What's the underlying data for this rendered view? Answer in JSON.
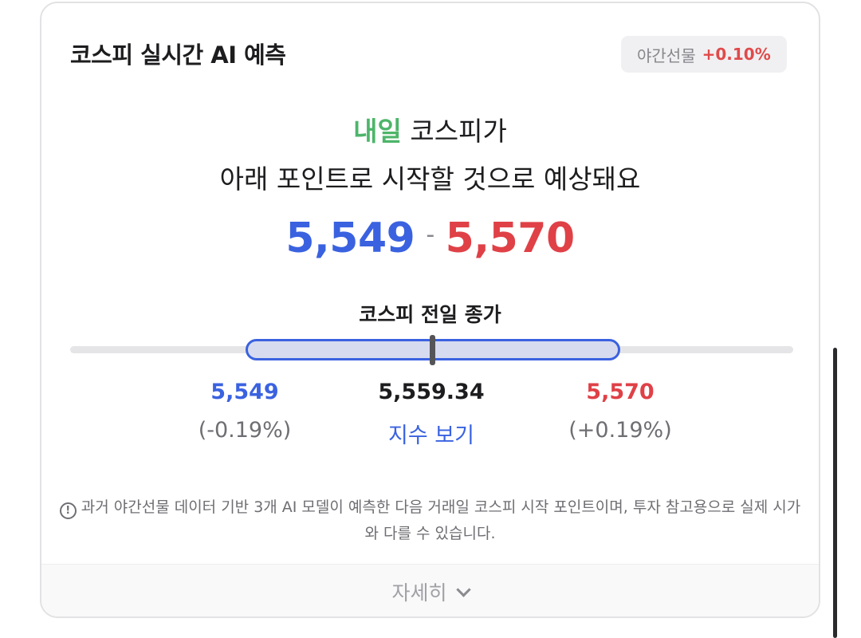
{
  "card": {
    "title": "코스피 실시간 AI 예측",
    "futures_badge": {
      "label": "야간선물",
      "change": "+0.10%"
    }
  },
  "headline": {
    "highlight": "내일",
    "line1_rest": " 코스피가",
    "line2": "아래 포인트로 시작할 것으로 예상돼요"
  },
  "forecast": {
    "low": "5,549",
    "separator": "-",
    "high": "5,570"
  },
  "prev_close": {
    "label": "코스피 전일 종가",
    "value": "5,559.34",
    "link": "지수 보기"
  },
  "range_values": {
    "low": {
      "value": "5,549",
      "change": "(-0.19%)"
    },
    "high": {
      "value": "5,570",
      "change": "(+0.19%)"
    }
  },
  "disclaimer": {
    "icon": "info-icon",
    "icon_glyph": "!",
    "text": "과거 야간선물 데이터 기반 3개 AI 모델이 예측한 다음 거래일 코스피 시작 포인트이며, 투자 참고용으로 실제 시가와 다를 수 있습니다."
  },
  "footer": {
    "label": "자세히",
    "icon": "chevron-down-icon"
  },
  "colors": {
    "low": "#3a62e0",
    "high": "#df4147",
    "accent_green": "#4db56a"
  }
}
